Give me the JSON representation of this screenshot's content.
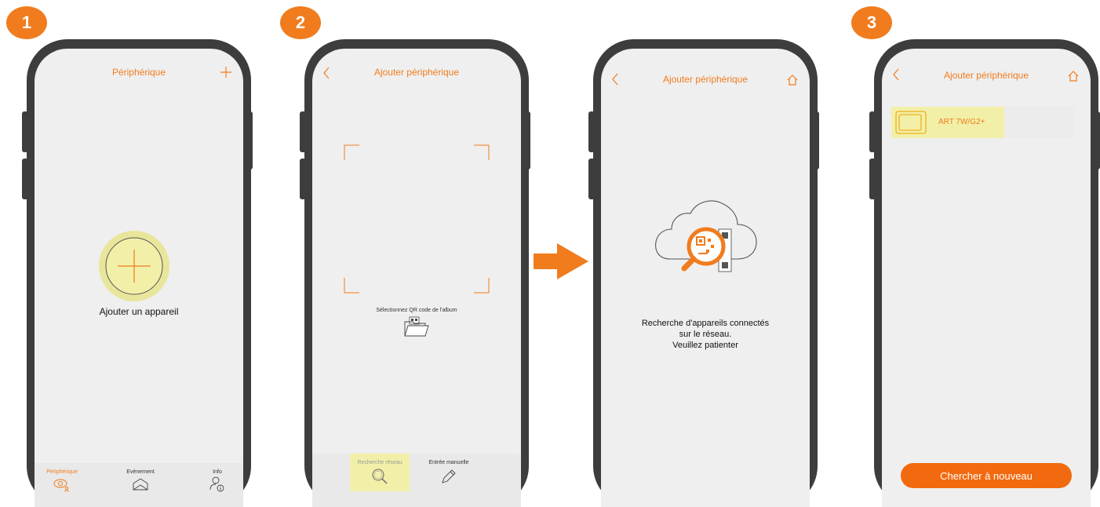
{
  "steps": [
    {
      "number": "1"
    },
    {
      "number": "2"
    },
    {
      "number": "3"
    }
  ],
  "phone1": {
    "title": "Périphérique",
    "add_label": "Ajouter un appareil",
    "tabs": [
      {
        "label": "Périphérique"
      },
      {
        "label": "Evènement"
      },
      {
        "label": "Info"
      }
    ]
  },
  "phone2": {
    "title": "Ajouter périphérique",
    "album_label": "Sélectionnez QR code de l'album",
    "tabs": [
      {
        "label": "Recherche réseau"
      },
      {
        "label": "Entrée manuelle"
      }
    ]
  },
  "phone3": {
    "title": "Ajouter périphérique",
    "status_lines": [
      "Recherche d'appareils connectés",
      "sur le réseau.",
      "Veuillez patienter"
    ]
  },
  "phone4": {
    "title": "Ajouter périphérique",
    "device_name": "ART 7W/G2+",
    "button_label": "Chercher à nouveau"
  },
  "colors": {
    "accent": "#f07c1e",
    "highlight": "#f2f0a8",
    "frame": "#3d3d3d",
    "screen": "#efefef"
  }
}
